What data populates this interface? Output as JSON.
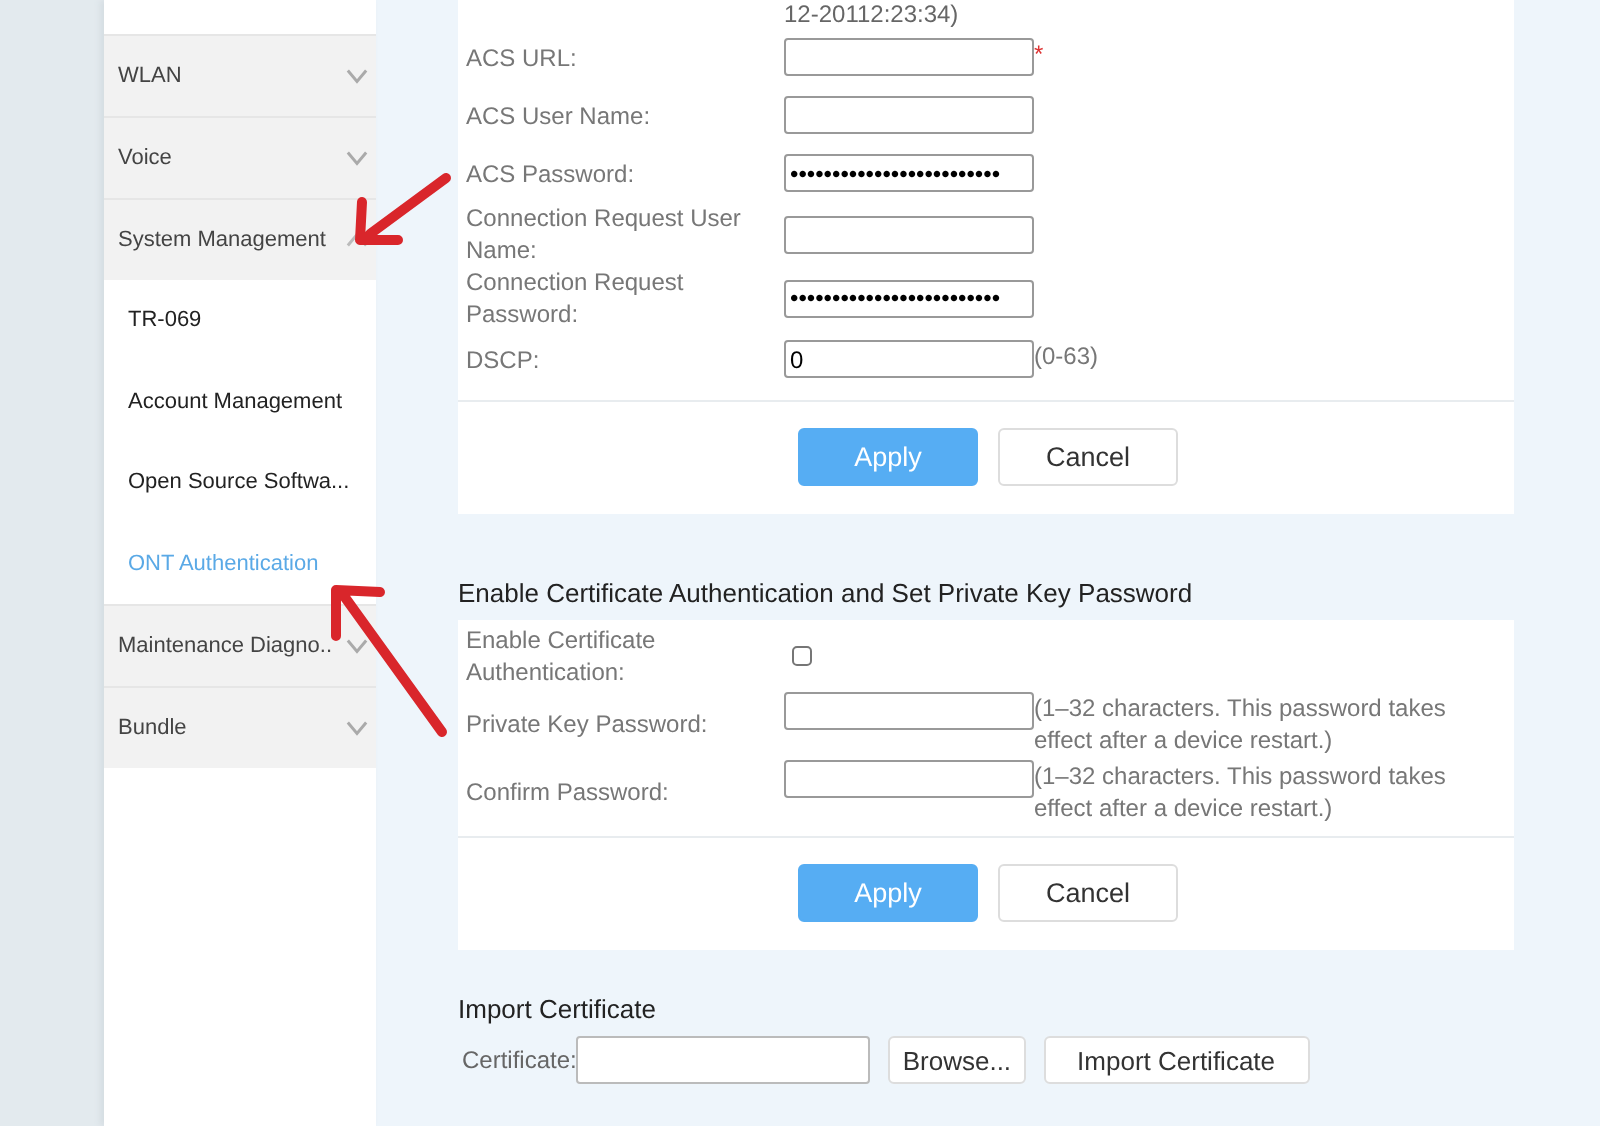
{
  "sidebar": {
    "groups": [
      {
        "label": "WLAN",
        "expanded": false
      },
      {
        "label": "Voice",
        "expanded": false
      },
      {
        "label": "System Management",
        "expanded": true,
        "children": [
          {
            "label": "TR-069",
            "selected": false
          },
          {
            "label": "Account Management",
            "selected": false
          },
          {
            "label": "Open Source Softwa...",
            "selected": false
          },
          {
            "label": "ONT Authentication",
            "selected": true
          }
        ]
      },
      {
        "label": "Maintenance Diagno..",
        "expanded": false
      },
      {
        "label": "Bundle",
        "expanded": false
      }
    ]
  },
  "tr069": {
    "top_note": "12-20112:23:34)",
    "fields": [
      {
        "label": "ACS URL:",
        "kind": "text",
        "required_mark": "*"
      },
      {
        "label": "ACS User Name:",
        "kind": "text"
      },
      {
        "label": "ACS Password:",
        "kind": "text",
        "value": "•••••••••••••••••••••••••"
      },
      {
        "label": "Connection Request User Name:",
        "kind": "text"
      },
      {
        "label": "Connection Request Password:",
        "kind": "text",
        "value": "•••••••••••••••••••••••••"
      },
      {
        "label": "DSCP:",
        "kind": "text",
        "value": "0",
        "hint": "(0-63)"
      }
    ],
    "buttons": [
      {
        "label": "Apply",
        "kind": "primary"
      },
      {
        "label": "Cancel",
        "kind": "secondary"
      }
    ]
  },
  "certificate": {
    "title": "Enable Certificate Authentication and Set Private Key Password",
    "fields": [
      {
        "label": "Enable Certificate Authentication:",
        "kind": "checkbox",
        "checked": false
      },
      {
        "label": "Private Key Password:",
        "kind": "text",
        "hint": "(1–32 characters. This password takes effect after a device restart.)"
      },
      {
        "label": "Confirm Password:",
        "kind": "text",
        "hint": "(1–32 characters. This password takes effect after a device restart.)"
      }
    ],
    "buttons": [
      {
        "label": "Apply",
        "kind": "primary"
      },
      {
        "label": "Cancel",
        "kind": "secondary"
      }
    ]
  },
  "import": {
    "title": "Import Certificate",
    "label": "Certificate:",
    "buttons": [
      {
        "label": "Browse..."
      },
      {
        "label": "Import Certificate"
      }
    ]
  }
}
